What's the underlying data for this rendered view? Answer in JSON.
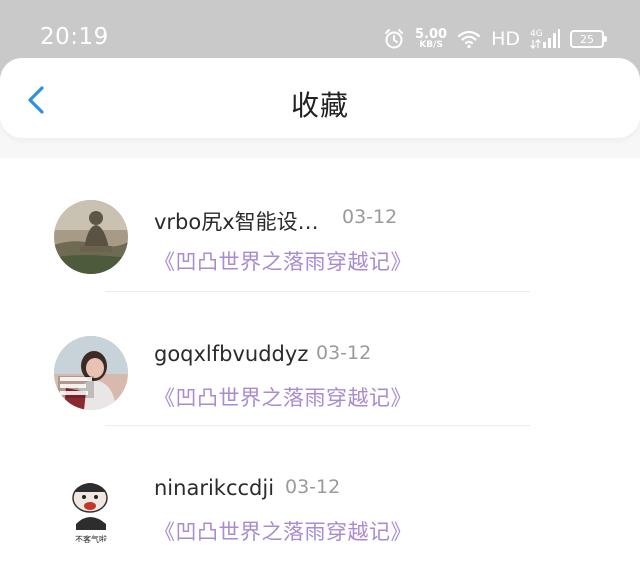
{
  "status_bar": {
    "time": "20:19",
    "speed_value": "5.00",
    "speed_unit": "KB/S",
    "network": "HD",
    "signal_label": "4G",
    "battery": "25"
  },
  "header": {
    "title": "收藏",
    "back_icon": "chevron-left-icon",
    "accent_color": "#2f8fe0"
  },
  "favorites": [
    {
      "username": "vrbo尻x智能设…",
      "date": "03-12",
      "book": "《凹凸世界之落雨穿越记》",
      "avatar": "buddha-statue"
    },
    {
      "username": "goqxlfbvuddyz",
      "date": "03-12",
      "book": "《凹凸世界之落雨穿越记》",
      "avatar": "girl-photo",
      "avatar_caption": "我生命中最好的 就那么多 全部给了你"
    },
    {
      "username": "ninarikccdji",
      "date": "03-12",
      "book": "《凹凸世界之落雨穿越记》",
      "avatar": "meme-face",
      "avatar_caption": "不客气啦"
    }
  ],
  "colors": {
    "book_title": "#a98bd1",
    "status_bar_bg": "#c9c9c9"
  }
}
